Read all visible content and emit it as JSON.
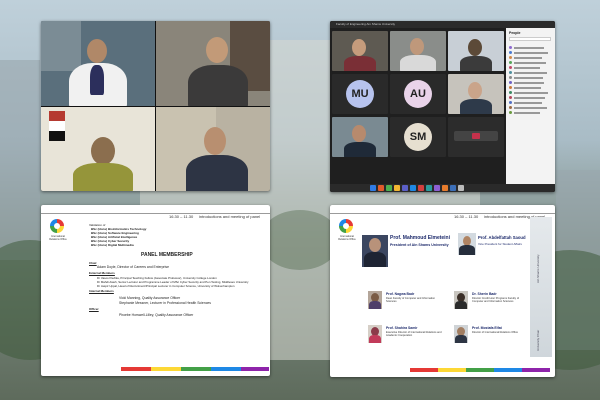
{
  "teams": {
    "window_title": "Faculty of Engineering Ain Shams University",
    "people_header": "People",
    "participants": [
      {
        "initials": "MU",
        "color": "#b7c3ee"
      },
      {
        "initials": "AU",
        "color": "#e9d3e9"
      },
      {
        "initials": "SM",
        "color": "#e6dfd0"
      }
    ]
  },
  "slide_left": {
    "time": "16.30 – 11.30",
    "topic": "introductions and meeting of panel",
    "validation_of": "Validation of",
    "programmes": [
      "BSc (Hons) Bioinformatics Technology",
      "BSc (Hons) Software Engineering",
      "BSc (Hons) Artificial Intelligence",
      "BSc (Hons) Cyber Security",
      "BSc (Hons) Digital Multimedia"
    ],
    "panel_title": "PANEL MEMBERSHIP",
    "chair_label": "Chair",
    "chair": "Adam Doyle, Director of Careers and Enterprise",
    "external_label": "External Members",
    "externals": [
      "Dr Vasos Pavlika, Principal Teaching Fellow (Associate Professor), University College London",
      "Dr Mahdi Aiash, Senior Lecturer and Programme Leader of MSc Cyber Security and Pen Testing, Middlesex University",
      "Dr Jaspir Uppal, Head of Recruitment/Principal Lecturer in Computer Science, University of Wolverhampton"
    ],
    "internal_label": "Internal Members",
    "internals": [
      "Vicki Manning, Quality Assurance Officer",
      "Stephanie Messner, Lecturer in Professional Health Sciences"
    ],
    "officer_label": "Officer",
    "officer": "Phoebe Horswell-Lilley, Quality Assurance Officer"
  },
  "slide_right": {
    "time": "16.30 – 11.30",
    "topic": "introductions and meeting of panel",
    "p1_name": "Prof. Mahmoud Elmeteini",
    "p1_role": "President of Ain Shams University",
    "p2_name": "Prof. Abdelfattah Saoud",
    "p2_role": "Vice President for Student Affairs",
    "p3_name": "Prof. Nagwa Badr",
    "p3_role": "Dean Faculty of Computer and Information Sciences",
    "p4_name": "Dr. Sherin Badr",
    "p4_role": "Director Credit Hour Programs Faculty of Computer and Information Sciences",
    "p5_name": "Prof. Shahira Samir",
    "p5_role": "Executive Director of International Relations and Academic Cooperation",
    "p6_name": "Prof. Mostafa Elfat",
    "p6_role": "Director of International Relations Office",
    "side_label_1": "Ain Shams University",
    "side_label_2": "University Chair"
  },
  "logo_caption": "International Relations Office",
  "colors": {
    "bar": [
      "#e53935",
      "#fdd835",
      "#43a047",
      "#1e88e5",
      "#8e24aa"
    ]
  }
}
